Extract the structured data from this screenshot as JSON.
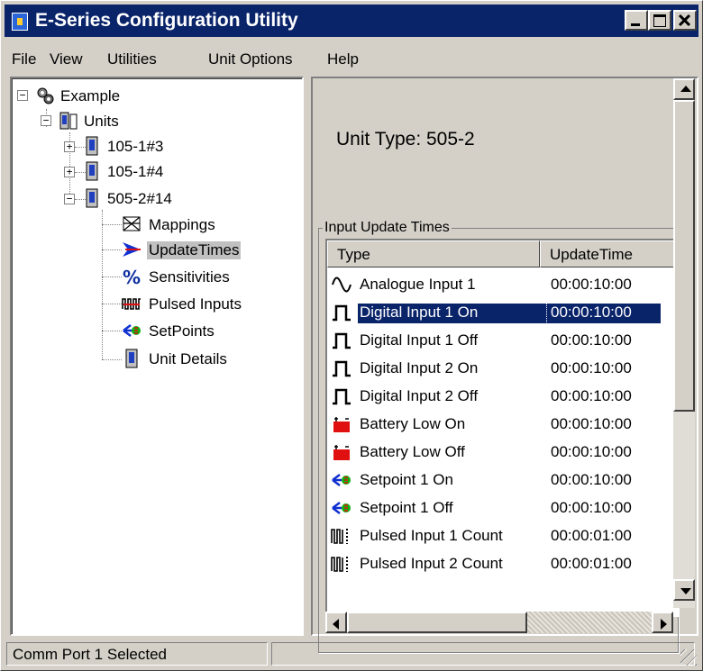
{
  "window": {
    "title": "E-Series Configuration Utility"
  },
  "menu": {
    "items": [
      {
        "label": "File"
      },
      {
        "label": "View"
      },
      {
        "label": "Utilities"
      },
      {
        "label": "Unit Options"
      },
      {
        "label": "Help"
      }
    ]
  },
  "tree": {
    "root": "Example",
    "units": "Units",
    "unit_a": "105-1#3",
    "unit_b": "105-1#4",
    "unit_c": "505-2#14",
    "children": [
      {
        "label": "Mappings",
        "icon": "mappings-icon"
      },
      {
        "label": "UpdateTimes",
        "icon": "update-times-icon"
      },
      {
        "label": "Sensitivities",
        "icon": "percent-icon"
      },
      {
        "label": "Pulsed Inputs",
        "icon": "pulsed-inputs-icon"
      },
      {
        "label": "SetPoints",
        "icon": "setpoint-icon"
      },
      {
        "label": "Unit Details",
        "icon": "unit-icon"
      }
    ],
    "selected": "UpdateTimes"
  },
  "detail": {
    "unit_type": "Unit Type: 505-2",
    "group_label": "Input Update Times",
    "columns": {
      "type": "Type",
      "update_time": "UpdateTime"
    },
    "rows": [
      {
        "type": "Analogue Input 1",
        "time": "00:00:10:00",
        "icon": "analogue-wave-icon"
      },
      {
        "type": "Digital Input 1 On",
        "time": "00:00:10:00",
        "icon": "digital-pulse-icon"
      },
      {
        "type": "Digital Input 1 Off",
        "time": "00:00:10:00",
        "icon": "digital-pulse-icon"
      },
      {
        "type": "Digital Input 2 On",
        "time": "00:00:10:00",
        "icon": "digital-pulse-icon"
      },
      {
        "type": "Digital Input 2 Off",
        "time": "00:00:10:00",
        "icon": "digital-pulse-icon"
      },
      {
        "type": "Battery Low On",
        "time": "00:00:10:00",
        "icon": "battery-icon"
      },
      {
        "type": "Battery Low Off",
        "time": "00:00:10:00",
        "icon": "battery-icon"
      },
      {
        "type": "Setpoint 1 On",
        "time": "00:00:10:00",
        "icon": "setpoint-icon"
      },
      {
        "type": "Setpoint 1 Off",
        "time": "00:00:10:00",
        "icon": "setpoint-icon"
      },
      {
        "type": "Pulsed Input 1 Count",
        "time": "00:00:01:00",
        "icon": "pulse-count-icon"
      },
      {
        "type": "Pulsed Input 2 Count",
        "time": "00:00:01:00",
        "icon": "pulse-count-icon"
      }
    ],
    "selected_row": "Digital Input 1 On"
  },
  "status": {
    "text": "Comm Port 1 Selected"
  },
  "colors": {
    "titlebar": "#0a246a",
    "face": "#d4d0c8",
    "selection": "#0a246a",
    "battery_red": "#e01010",
    "setpoint_blue": "#1030d0",
    "setpoint_green": "#10b010"
  }
}
